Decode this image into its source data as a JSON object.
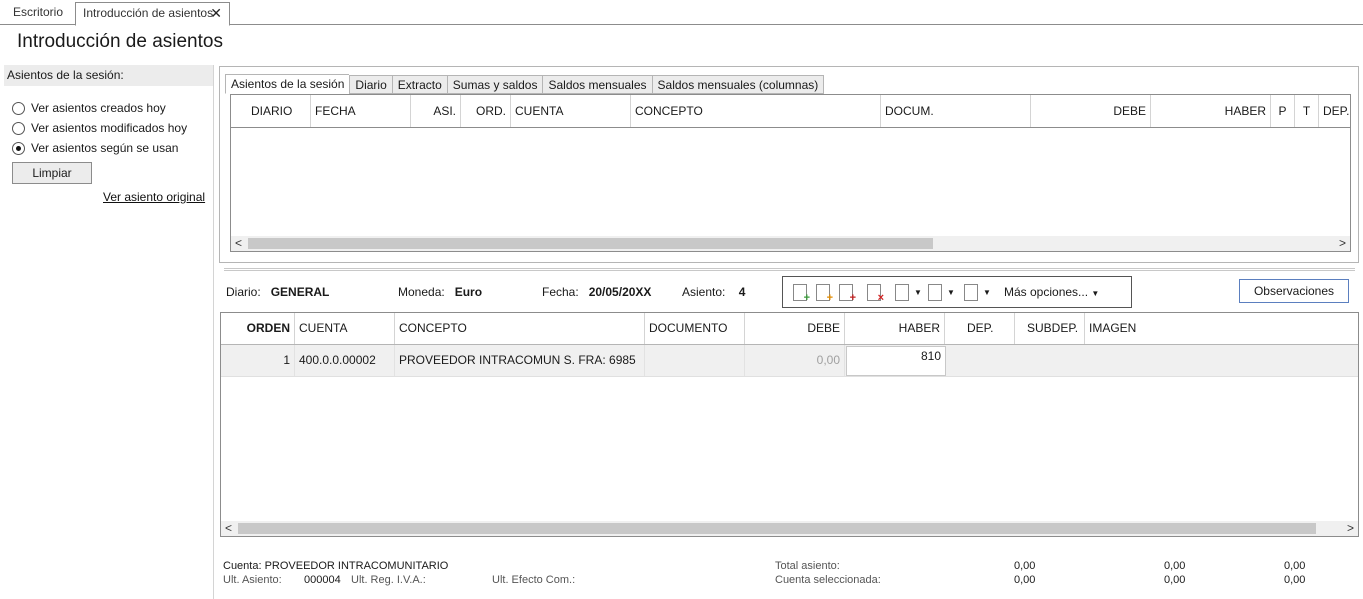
{
  "doc_tabs": {
    "escritorio": "Escritorio",
    "active": "Introducción de asientos",
    "close": "✕"
  },
  "page_title": "Introducción de asientos",
  "left_panel": {
    "header": "Asientos de la sesión:",
    "options": [
      "Ver asientos creados hoy",
      "Ver asientos modificados hoy",
      "Ver asientos según se usan"
    ],
    "selected_index": 2,
    "clear_button": "Limpiar",
    "link": "Ver asiento original"
  },
  "upper": {
    "tabs": [
      "Asientos de la sesión",
      "Diario",
      "Extracto",
      "Sumas y saldos",
      "Saldos mensuales",
      "Saldos mensuales (columnas)"
    ],
    "columns": [
      "DIARIO",
      "FECHA",
      "ASI.",
      "ORD.",
      "CUENTA",
      "CONCEPTO",
      "DOCUM.",
      "DEBE",
      "HABER",
      "P",
      "T",
      "DEP."
    ]
  },
  "info": {
    "diario_label": "Diario:",
    "diario": "GENERAL",
    "moneda_label": "Moneda:",
    "moneda": "Euro",
    "fecha_label": "Fecha:",
    "fecha": "20/05/20XX",
    "asiento_label": "Asiento:",
    "asiento": "4",
    "more_options": "Más opciones...",
    "observaciones": "Observaciones"
  },
  "lower": {
    "columns": [
      "ORDEN",
      "CUENTA",
      "CONCEPTO",
      "DOCUMENTO",
      "DEBE",
      "HABER",
      "DEP.",
      "SUBDEP.",
      "IMAGEN"
    ],
    "rows": [
      {
        "orden": "1",
        "cuenta": "400.0.0.00002",
        "concepto": "PROVEEDOR INTRACOMUN S. FRA:  6985",
        "documento": "",
        "debe": "0,00",
        "haber": "810"
      }
    ]
  },
  "footer": {
    "cuenta": "Cuenta: PROVEEDOR INTRACOMUNITARIO",
    "ult_asiento_label": "Ult. Asiento:",
    "ult_asiento": "000004",
    "ult_iva_label": "Ult. Reg. I.V.A.:",
    "ult_efecto_label": "Ult. Efecto Com.:",
    "total_asiento_label": "Total asiento:",
    "cuenta_sel_label": "Cuenta seleccionada:",
    "total_values": [
      "0,00",
      "0,00",
      "0,00"
    ],
    "cuenta_values": [
      "0,00",
      "0,00",
      "0,00"
    ]
  },
  "scroll": {
    "left": "<",
    "right": ">"
  }
}
